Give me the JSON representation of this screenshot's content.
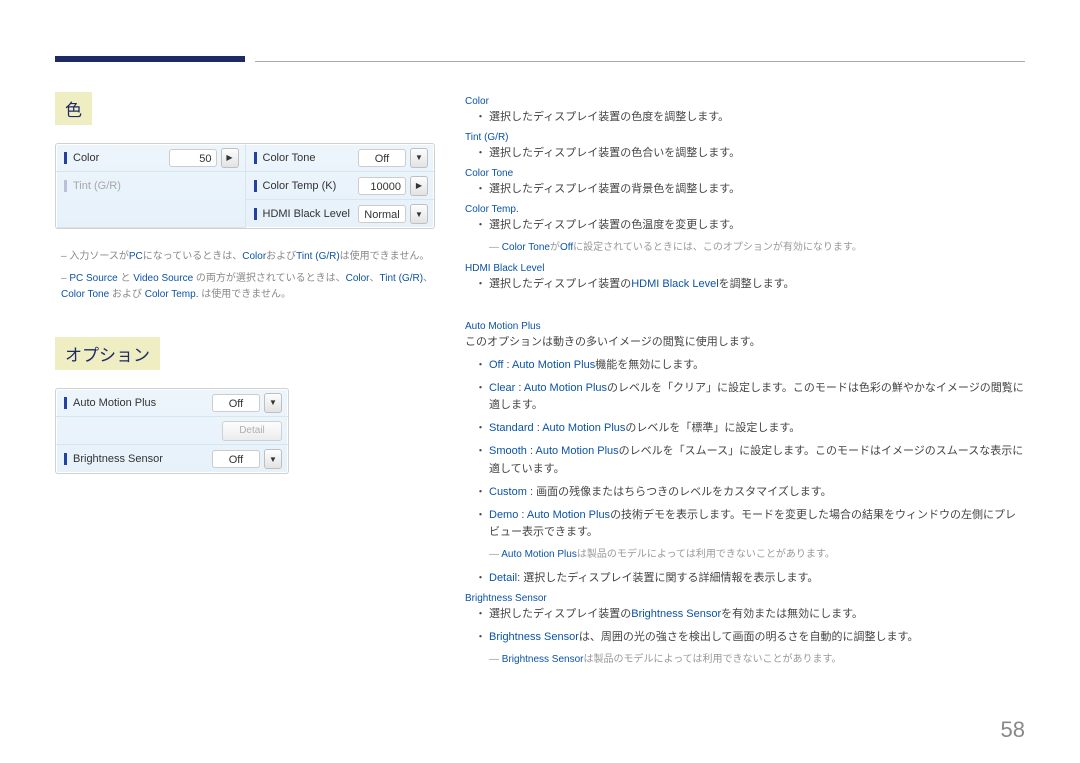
{
  "pageNumber": "58",
  "sections": {
    "color": {
      "title": "色",
      "panel": {
        "colorLabel": "Color",
        "colorValue": "50",
        "tintLabel": "Tint (G/R)",
        "colorToneLabel": "Color Tone",
        "colorToneValue": "Off",
        "colorTempLabel": "Color Temp (K)",
        "colorTempValue": "10000",
        "hdmiLabel": "HDMI Black Level",
        "hdmiValue": "Normal"
      },
      "note1a": "– 入力ソースが",
      "note1b": "PC",
      "note1c": "になっているときは、",
      "note1d": "Color",
      "note1e": "および",
      "note1f": "Tint (G/R)",
      "note1g": "は使用できません。",
      "note2a": "– ",
      "note2b": "PC Source",
      "note2c": " と ",
      "note2d": "Video Source",
      "note2e": " の両方が選択されているときは、",
      "note2f": "Color",
      "note2g": "、",
      "note2h": "Tint (G/R)",
      "note2i": "、",
      "note2j": "Color Tone",
      "note2k": " および ",
      "note2l": "Color Temp.",
      "note2m": " は使用できません。"
    },
    "option": {
      "title": "オプション",
      "panel": {
        "ampLabel": "Auto Motion Plus",
        "ampValue": "Off",
        "detailLabel": "Detail",
        "brightLabel": "Brightness Sensor",
        "brightValue": "Off"
      }
    }
  },
  "right": {
    "color": {
      "head": "Color",
      "b1": "選択したディスプレイ装置の色度を調整します。"
    },
    "tint": {
      "head": "Tint (G/R)",
      "b1": "選択したディスプレイ装置の色合いを調整します。"
    },
    "tone": {
      "head": "Color Tone",
      "b1": "選択したディスプレイ装置の背景色を調整します。"
    },
    "temp": {
      "head": "Color Temp.",
      "b1": "選択したディスプレイ装置の色温度を変更します。",
      "sub_a": "Color Tone",
      "sub_b": "が",
      "sub_c": "Off",
      "sub_d": "に設定されているときには、このオプションが有効になります。"
    },
    "hdmi": {
      "head": "HDMI Black Level",
      "b1a": "選択したディスプレイ装置の",
      "b1b": "HDMI Black Level",
      "b1c": "を調整します。"
    },
    "amp": {
      "head": "Auto Motion Plus",
      "intro": "このオプションは動きの多いイメージの閲覧に使用します。",
      "b1a": "Off",
      "b1b": " : ",
      "b1c": "Auto Motion Plus",
      "b1d": "機能を無効にします。",
      "b2a": "Clear",
      "b2b": " : ",
      "b2c": "Auto Motion Plus",
      "b2d": "のレベルを「クリア」に設定します。このモードは色彩の鮮やかなイメージの閲覧に適します。",
      "b3a": "Standard",
      "b3b": " : ",
      "b3c": "Auto Motion Plus",
      "b3d": "のレベルを「標準」に設定します。",
      "b4a": "Smooth",
      "b4b": " : ",
      "b4c": "Auto Motion Plus",
      "b4d": "のレベルを「スムース」に設定します。このモードはイメージのスムースな表示に適しています。",
      "b5a": "Custom",
      "b5b": " : 画面の残像またはちらつきのレベルをカスタマイズします。",
      "b6a": "Demo",
      "b6b": " : ",
      "b6c": "Auto Motion Plus",
      "b6d": "の技術デモを表示します。モードを変更した場合の結果をウィンドウの左側にプレビュー表示できます。",
      "sub_a": "Auto Motion Plus",
      "sub_b": "は製品のモデルによっては利用できないことがあります。",
      "b7a": "Detail",
      "b7b": ": 選択したディスプレイ装置に関する詳細情報を表示します。"
    },
    "bs": {
      "head": "Brightness Sensor",
      "b1a": "選択したディスプレイ装置の",
      "b1b": "Brightness Sensor",
      "b1c": "を有効または無効にします。",
      "b2a": "Brightness Sensor",
      "b2b": "は、周囲の光の強さを検出して画面の明るさを自動的に調整します。",
      "sub_a": "Brightness Sensor",
      "sub_b": "は製品のモデルによっては利用できないことがあります。"
    }
  }
}
